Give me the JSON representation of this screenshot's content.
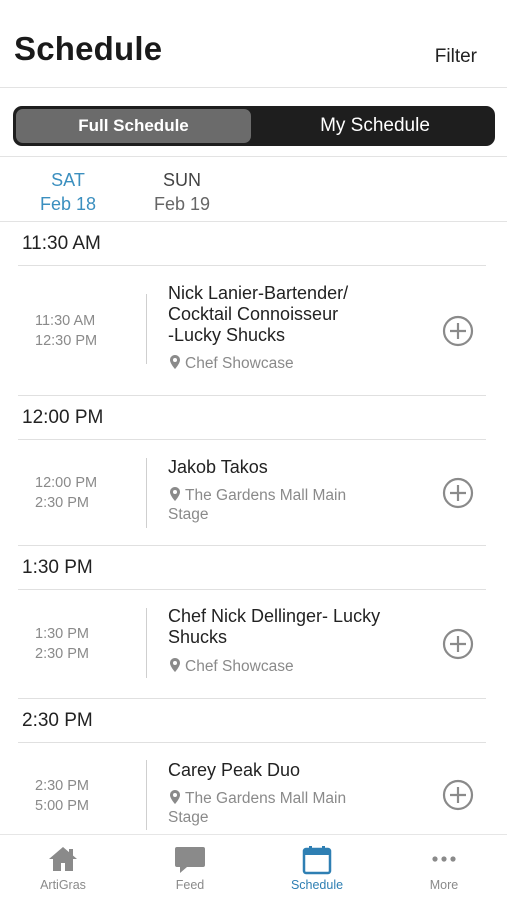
{
  "header": {
    "title": "Schedule",
    "filter_label": "Filter"
  },
  "segments": {
    "full": "Full Schedule",
    "mine": "My Schedule",
    "selected": "Full Schedule"
  },
  "days": [
    {
      "dow": "SAT",
      "date": "Feb 18",
      "active": true
    },
    {
      "dow": "SUN",
      "date": "Feb 19",
      "active": false
    }
  ],
  "slots": [
    {
      "header": "11:30 AM",
      "start": "11:30 AM",
      "end": "12:30 PM",
      "title_lines": [
        "Nick Lanier-Bartender/",
        "Cocktail Connoisseur",
        "-Lucky Shucks"
      ],
      "location_lines": [
        "Chef Showcase"
      ]
    },
    {
      "header": "12:00 PM",
      "start": "12:00 PM",
      "end": "2:30 PM",
      "title_lines": [
        "Jakob Takos"
      ],
      "location_lines": [
        "The Gardens Mall Main",
        "Stage"
      ]
    },
    {
      "header": "1:30 PM",
      "start": "1:30 PM",
      "end": "2:30 PM",
      "title_lines": [
        "Chef Nick Dellinger- Lucky",
        "Shucks"
      ],
      "location_lines": [
        "Chef Showcase"
      ]
    },
    {
      "header": "2:30 PM",
      "start": "2:30 PM",
      "end": "5:00 PM",
      "title_lines": [
        "Carey Peak Duo"
      ],
      "location_lines": [
        "The Gardens Mall Main",
        "Stage"
      ]
    }
  ],
  "tabbar": {
    "items": [
      {
        "label": "ArtiGras",
        "icon": "home-icon"
      },
      {
        "label": "Feed",
        "icon": "chat-bubble-icon"
      },
      {
        "label": "Schedule",
        "icon": "calendar-icon",
        "active": true
      },
      {
        "label": "More",
        "icon": "more-dots-icon"
      }
    ]
  },
  "colors": {
    "accent": "#3b8fbf",
    "segment_bg": "#1e1e1e",
    "segment_selected": "#6b6b6b",
    "muted": "#8a8a8a"
  }
}
